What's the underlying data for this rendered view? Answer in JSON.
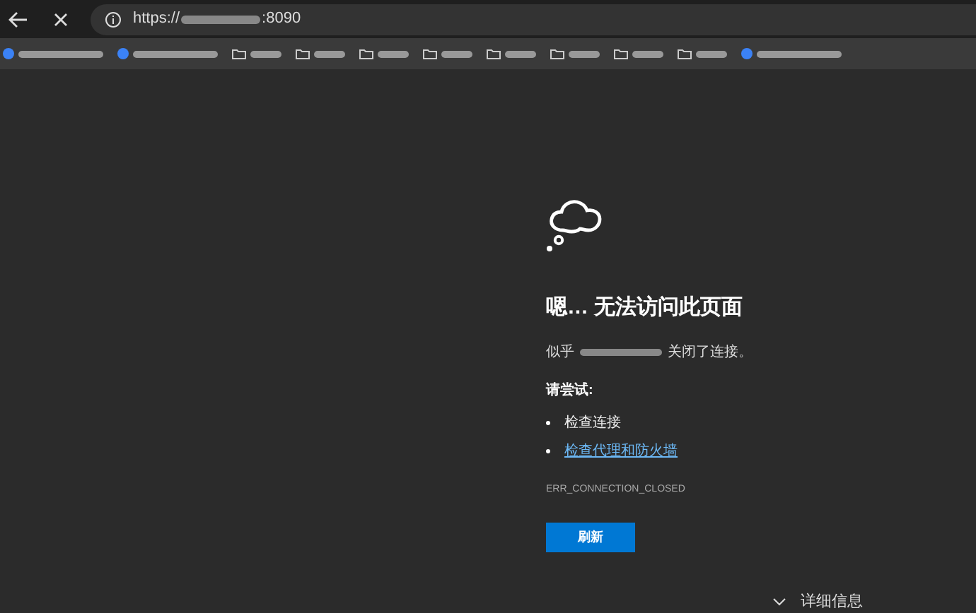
{
  "toolbar": {
    "url_scheme": "https://",
    "url_port": ":8090"
  },
  "bookmarks": [
    {
      "kind": "site"
    },
    {
      "kind": "site"
    },
    {
      "kind": "folder"
    },
    {
      "kind": "folder"
    },
    {
      "kind": "folder"
    },
    {
      "kind": "folder"
    },
    {
      "kind": "folder"
    },
    {
      "kind": "folder"
    },
    {
      "kind": "folder"
    },
    {
      "kind": "folder"
    },
    {
      "kind": "site"
    }
  ],
  "error": {
    "title": "嗯… 无法访问此页面",
    "message_before": "似乎",
    "message_after": "关闭了连接。",
    "try_heading": "请尝试:",
    "suggestions": [
      {
        "text": "检查连接",
        "link": false
      },
      {
        "text": "检查代理和防火墙",
        "link": true
      }
    ],
    "code": "ERR_CONNECTION_CLOSED",
    "button": "刷新",
    "details": "详细信息"
  }
}
